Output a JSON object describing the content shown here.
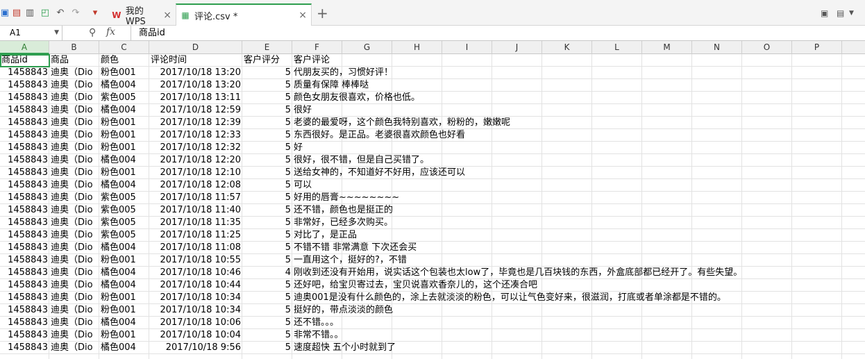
{
  "toolbar": {
    "icons": [
      "save-icon",
      "export-pdf-icon",
      "print-icon",
      "print-preview-icon",
      "undo-icon",
      "redo-icon"
    ],
    "right_icons": [
      "minimize-icon",
      "skin-icon"
    ]
  },
  "tabs": [
    {
      "label": "我的WPS",
      "icon": "wps-icon",
      "close": "×"
    },
    {
      "label": "评论.csv *",
      "icon": "spreadsheet-icon",
      "close": "×"
    }
  ],
  "tab_add": "+",
  "formula_bar": {
    "name_box": "A1",
    "fx": "fx",
    "value": "商品id"
  },
  "columns": [
    "A",
    "B",
    "C",
    "D",
    "E",
    "F",
    "G",
    "H",
    "I",
    "J",
    "K",
    "L",
    "M",
    "N",
    "O",
    "P"
  ],
  "header_row": [
    "商品id",
    "商品",
    "颜色",
    "评论时间",
    "客户评分",
    "客户评论"
  ],
  "rows": [
    [
      "1458843",
      "迪奥（Dio",
      "粉色001",
      "2017/10/18 13:20",
      "5",
      "代朋友买的，习惯好评！"
    ],
    [
      "1458843",
      "迪奥（Dio",
      "橘色004",
      "2017/10/18 13:20",
      "5",
      "质量有保障 棒棒哒"
    ],
    [
      "1458843",
      "迪奥（Dio",
      "紫色005",
      "2017/10/18 13:11",
      "5",
      "颜色女朋友很喜欢，价格也低。"
    ],
    [
      "1458843",
      "迪奥（Dio",
      "橘色004",
      "2017/10/18 12:59",
      "5",
      "很好"
    ],
    [
      "1458843",
      "迪奥（Dio",
      "粉色001",
      "2017/10/18 12:39",
      "5",
      "老婆的最爱呀，这个颜色我特别喜欢，粉粉的，嫩嫩呢"
    ],
    [
      "1458843",
      "迪奥（Dio",
      "粉色001",
      "2017/10/18 12:33",
      "5",
      "东西很好。是正品。老婆很喜欢颜色也好看"
    ],
    [
      "1458843",
      "迪奥（Dio",
      "粉色001",
      "2017/10/18 12:32",
      "5",
      "好"
    ],
    [
      "1458843",
      "迪奥（Dio",
      "橘色004",
      "2017/10/18 12:20",
      "5",
      "很好，很不错，但是自己买错了。"
    ],
    [
      "1458843",
      "迪奥（Dio",
      "粉色001",
      "2017/10/18 12:10",
      "5",
      "送给女神的，不知道好不好用，应该还可以"
    ],
    [
      "1458843",
      "迪奥（Dio",
      "橘色004",
      "2017/10/18 12:08",
      "5",
      "可以"
    ],
    [
      "1458843",
      "迪奥（Dio",
      "紫色005",
      "2017/10/18 11:57",
      "5",
      "好用的唇膏~~~~~~~~"
    ],
    [
      "1458843",
      "迪奥（Dio",
      "紫色005",
      "2017/10/18 11:40",
      "5",
      "还不错，颜色也是挺正的"
    ],
    [
      "1458843",
      "迪奥（Dio",
      "紫色005",
      "2017/10/18 11:35",
      "5",
      "非常好，已经多次购买。"
    ],
    [
      "1458843",
      "迪奥（Dio",
      "紫色005",
      "2017/10/18 11:25",
      "5",
      "对比了，是正品"
    ],
    [
      "1458843",
      "迪奥（Dio",
      "橘色004",
      "2017/10/18 11:08",
      "5",
      "不错不错 非常满意 下次还会买"
    ],
    [
      "1458843",
      "迪奥（Dio",
      "粉色001",
      "2017/10/18 10:55",
      "5",
      "一直用这个，挺好的?，不错"
    ],
    [
      "1458843",
      "迪奥（Dio",
      "橘色004",
      "2017/10/18 10:46",
      "4",
      "刚收到还没有开始用，说实话这个包装也太low了，毕竟也是几百块钱的东西，外盒底部都已经开了。有些失望。"
    ],
    [
      "1458843",
      "迪奥（Dio",
      "橘色004",
      "2017/10/18 10:44",
      "5",
      "还好吧，给宝贝寄过去，宝贝说喜欢香奈儿的，这个还凑合吧"
    ],
    [
      "1458843",
      "迪奥（Dio",
      "粉色001",
      "2017/10/18 10:34",
      "5",
      "迪奥001是没有什么颜色的，涂上去就淡淡的粉色，可以让气色变好来，很滋润，打底或者单涂都是不错的。"
    ],
    [
      "1458843",
      "迪奥（Dio",
      "粉色001",
      "2017/10/18 10:34",
      "5",
      "挺好的，带点淡淡的颜色"
    ],
    [
      "1458843",
      "迪奥（Dio",
      "橘色004",
      "2017/10/18 10:06",
      "5",
      "还不错。。。"
    ],
    [
      "1458843",
      "迪奥（Dio",
      "粉色001",
      "2017/10/18 10:04",
      "5",
      "非常不错。。"
    ],
    [
      "1458843",
      "迪奥（Dio",
      "橘色004",
      "2017/10/18 9:56",
      "5",
      "速度超快    五个小时就到了"
    ]
  ],
  "colors": {
    "accent": "#2e9e4f",
    "grid_line": "#e2e2e2",
    "header_bg": "#f0f0f0"
  }
}
